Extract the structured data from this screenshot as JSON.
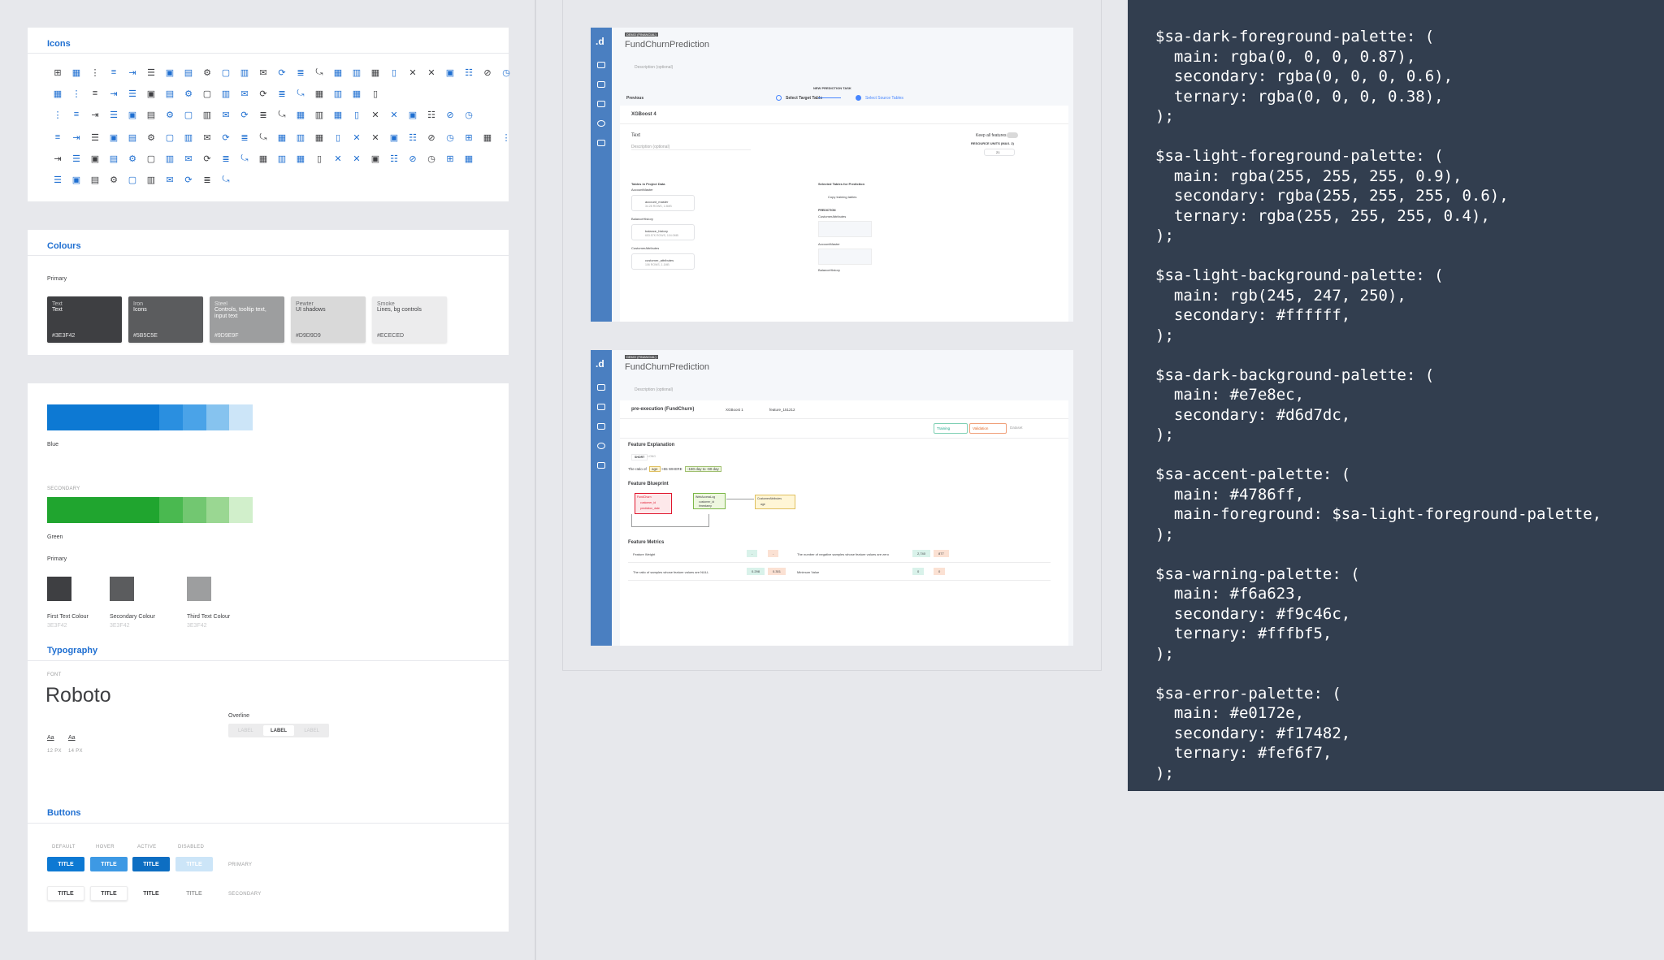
{
  "icons_section": {
    "title": "Icons"
  },
  "colours": {
    "title": "Colours",
    "primary_label": "Primary",
    "swatches": [
      {
        "name": "Text",
        "desc": "Text",
        "hex": "#3E3F42",
        "bg": "#3e3f42"
      },
      {
        "name": "Iron",
        "desc": "Icons",
        "hex": "#5B5C5E",
        "bg": "#5b5c5e"
      },
      {
        "name": "Steel",
        "desc": "Controls, tooltip text, input text",
        "hex": "#9D9E9F",
        "bg": "#9d9e9f"
      },
      {
        "name": "Pewter",
        "desc": "UI shadows",
        "hex": "#D9D9D9",
        "bg": "#d9d9d9"
      },
      {
        "name": "Smoke",
        "desc": "Lines, bg controls",
        "hex": "#ECECED",
        "bg": "#ececed"
      }
    ]
  },
  "palette": {
    "blue_label": "Blue",
    "secondary_label": "SECONDARY",
    "green_label": "Green",
    "primary_label": "Primary",
    "text_colours": [
      {
        "label": "First Text Colour",
        "hex": "3E3F42",
        "bg": "#3e3f42"
      },
      {
        "label": "Secondary Colour",
        "hex": "3E3F42",
        "bg": "#5b5c5e"
      },
      {
        "label": "Third Text Colour",
        "hex": "3E3F42",
        "bg": "#9d9e9f"
      }
    ]
  },
  "typography": {
    "title": "Typography",
    "font_label": "FONT",
    "font_name": "Roboto",
    "overline_label": "Overline",
    "overline_tabs": [
      "LABEL",
      "LABEL",
      "LABEL"
    ],
    "sizes": [
      {
        "sample": "Aa",
        "size": "12 PX"
      },
      {
        "sample": "Aa",
        "size": "14 PX"
      }
    ]
  },
  "buttons": {
    "title": "Buttons",
    "states": [
      "DEFAULT",
      "HOVER",
      "ACTIVE",
      "DISABLED"
    ],
    "label": "TITLE",
    "primary_label": "PRIMARY",
    "secondary_label": "SECONDARY"
  },
  "shot1": {
    "logo": ".d",
    "badge": "DEMO (FINANCIAL)",
    "title": "FundChurnPrediction",
    "description": "Description (optional)",
    "task_title": "NEW PREDICTION TASK",
    "previous": "Previous",
    "step1": "Select Target Table",
    "step2": "Select Source Tables",
    "model": "XGBoost 4",
    "text_label": "Text",
    "desc2": "Description (optional)",
    "keep_all": "Keep all features",
    "resource_units": "RESOURCE UNITS (MAX. 2)",
    "stepper_value": "21",
    "tables_in_project": "Tables in Project Data",
    "selected_tables": "Selected Tables for Prediction",
    "copy_training": "Copy training tables",
    "prediction_label": "PREDICTION",
    "tables": [
      {
        "group": "AccountMaster",
        "name": "account_master",
        "meta": "34.28 ROWS, 1.5MB"
      },
      {
        "group": "BalanceHistory",
        "name": "balance_history",
        "meta": "653.57K ROWS, 104.0MB"
      },
      {
        "group": "CustomerAttributes",
        "name": "customer_attributes",
        "meta": "106 ROWS, 1.1MB"
      }
    ],
    "selected": [
      "CustomerAttributes",
      "AccountMaster",
      "BalanceHistory"
    ]
  },
  "shot2": {
    "logo": ".d",
    "badge": "DEMO (FINANCIAL)",
    "title": "FundChurnPrediction",
    "description": "Description (optional)",
    "crumb1": "pre-execution (FundChurn)",
    "crumb2": "XGBoost 1",
    "crumb3": "feature_151212",
    "training": "Training",
    "validation": "Validation",
    "dataset": "Dataset",
    "feature_explanation": "Feature Explanation",
    "tab_short": "SHORT",
    "tab_long": "LONG",
    "ratio_text": "The ratio of",
    "chip_age": "age",
    "where_text": ">55 WHERE",
    "chip_range": "-180 day to -90 day",
    "feature_blueprint": "Feature Blueprint",
    "bp1_title": "FundChurn",
    "bp1_items": [
      "customer_id",
      "prediction_date"
    ],
    "bp2_title": "WebAccessLog",
    "bp2_items": [
      "customer_id",
      "timestamp"
    ],
    "bp3_title": "CustomerAttributes",
    "bp3_items": [
      "age"
    ],
    "feature_metrics": "Feature Metrics",
    "metrics": [
      {
        "label": "Feature Weight",
        "v1": "-",
        "v2": "-",
        "label2": "The number of negative samples whose feature values are zero",
        "v3": "2,740",
        "v4": "877"
      },
      {
        "label": "The ratio of samples whose feature values are NULL",
        "v1": "0.298",
        "v2": "0.301",
        "label2": "Minimum Value",
        "v3": "0",
        "v4": "0"
      }
    ]
  },
  "code": {
    "text": "$sa-dark-foreground-palette: (\n  main: rgba(0, 0, 0, 0.87),\n  secondary: rgba(0, 0, 0, 0.6),\n  ternary: rgba(0, 0, 0, 0.38),\n);\n\n$sa-light-foreground-palette: (\n  main: rgba(255, 255, 255, 0.9),\n  secondary: rgba(255, 255, 255, 0.6),\n  ternary: rgba(255, 255, 255, 0.4),\n);\n\n$sa-light-background-palette: (\n  main: rgb(245, 247, 250),\n  secondary: #ffffff,\n);\n\n$sa-dark-background-palette: (\n  main: #e7e8ec,\n  secondary: #d6d7dc,\n);\n\n$sa-accent-palette: (\n  main: #4786ff,\n  main-foreground: $sa-light-foreground-palette,\n);\n\n$sa-warning-palette: (\n  main: #f6a623,\n  secondary: #f9c46c,\n  ternary: #fffbf5,\n);\n\n$sa-error-palette: (\n  main: #e0172e,\n  secondary: #f17482,\n  ternary: #fef6f7,\n);"
  },
  "colors": {
    "accent": "#1f6fd1",
    "blue_shades": [
      "#0d79d3",
      "#2a8fe0",
      "#4aa3e8",
      "#86c3ef",
      "#cce5f8"
    ],
    "green_shades": [
      "#20a52f",
      "#4ab950",
      "#72c771",
      "#9ad792",
      "#d1efcb"
    ]
  }
}
